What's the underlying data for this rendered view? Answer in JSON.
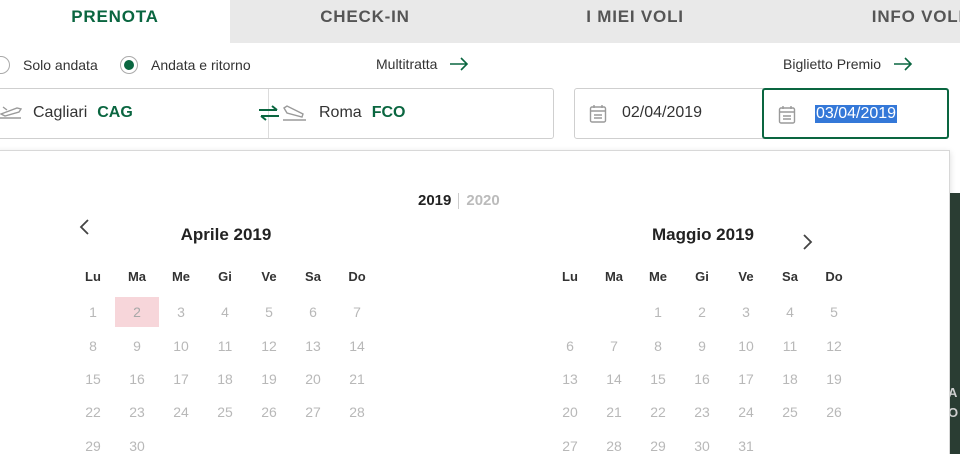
{
  "tabs": [
    "PRENOTA",
    "CHECK-IN",
    "I MIEI VOLI",
    "INFO VOLI"
  ],
  "trip_type": {
    "one_way": "Solo andata",
    "round_trip": "Andata e ritorno",
    "selected": "round_trip"
  },
  "links": {
    "multi_city": "Multitratta",
    "award_ticket": "Biglietto Premio"
  },
  "route": {
    "from_city": "Cagliari",
    "from_code": "CAG",
    "to_city": "Roma",
    "to_code": "FCO"
  },
  "dates": {
    "departure": "02/04/2019",
    "return": "03/04/2019"
  },
  "calendar": {
    "year_active": "2019",
    "year_inactive": "2020",
    "weekdays": [
      "Lu",
      "Ma",
      "Me",
      "Gi",
      "Ve",
      "Sa",
      "Do"
    ],
    "months": [
      {
        "title": "Aprile 2019",
        "first_weekday_index": 0,
        "days_shown": 30,
        "highlighted_day": 2
      },
      {
        "title": "Maggio 2019",
        "first_weekday_index": 2,
        "days_shown": 31,
        "highlighted_day": null
      }
    ]
  },
  "colors": {
    "brand_green": "#0a6640",
    "tab_bg": "#e9e9e9",
    "highlight_day": "#f7d6da",
    "text_selection": "#3478d8"
  },
  "icons": [
    "arrow-right-icon",
    "plane-takeoff-icon",
    "plane-landing-icon",
    "swap-icon",
    "calendar-icon",
    "chevron-left-icon",
    "chevron-right-icon"
  ]
}
